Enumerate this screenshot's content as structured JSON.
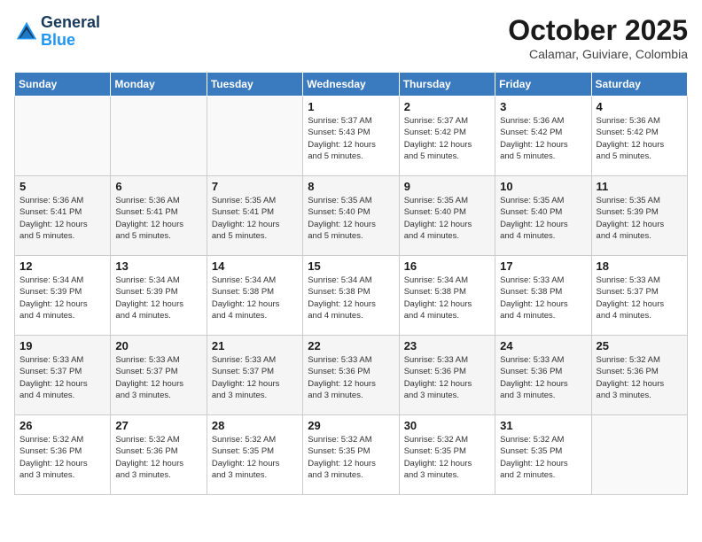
{
  "header": {
    "logo_line1": "General",
    "logo_line2": "Blue",
    "month": "October 2025",
    "location": "Calamar, Guiviare, Colombia"
  },
  "weekdays": [
    "Sunday",
    "Monday",
    "Tuesday",
    "Wednesday",
    "Thursday",
    "Friday",
    "Saturday"
  ],
  "weeks": [
    [
      {
        "day": "",
        "info": ""
      },
      {
        "day": "",
        "info": ""
      },
      {
        "day": "",
        "info": ""
      },
      {
        "day": "1",
        "info": "Sunrise: 5:37 AM\nSunset: 5:43 PM\nDaylight: 12 hours\nand 5 minutes."
      },
      {
        "day": "2",
        "info": "Sunrise: 5:37 AM\nSunset: 5:42 PM\nDaylight: 12 hours\nand 5 minutes."
      },
      {
        "day": "3",
        "info": "Sunrise: 5:36 AM\nSunset: 5:42 PM\nDaylight: 12 hours\nand 5 minutes."
      },
      {
        "day": "4",
        "info": "Sunrise: 5:36 AM\nSunset: 5:42 PM\nDaylight: 12 hours\nand 5 minutes."
      }
    ],
    [
      {
        "day": "5",
        "info": "Sunrise: 5:36 AM\nSunset: 5:41 PM\nDaylight: 12 hours\nand 5 minutes."
      },
      {
        "day": "6",
        "info": "Sunrise: 5:36 AM\nSunset: 5:41 PM\nDaylight: 12 hours\nand 5 minutes."
      },
      {
        "day": "7",
        "info": "Sunrise: 5:35 AM\nSunset: 5:41 PM\nDaylight: 12 hours\nand 5 minutes."
      },
      {
        "day": "8",
        "info": "Sunrise: 5:35 AM\nSunset: 5:40 PM\nDaylight: 12 hours\nand 5 minutes."
      },
      {
        "day": "9",
        "info": "Sunrise: 5:35 AM\nSunset: 5:40 PM\nDaylight: 12 hours\nand 4 minutes."
      },
      {
        "day": "10",
        "info": "Sunrise: 5:35 AM\nSunset: 5:40 PM\nDaylight: 12 hours\nand 4 minutes."
      },
      {
        "day": "11",
        "info": "Sunrise: 5:35 AM\nSunset: 5:39 PM\nDaylight: 12 hours\nand 4 minutes."
      }
    ],
    [
      {
        "day": "12",
        "info": "Sunrise: 5:34 AM\nSunset: 5:39 PM\nDaylight: 12 hours\nand 4 minutes."
      },
      {
        "day": "13",
        "info": "Sunrise: 5:34 AM\nSunset: 5:39 PM\nDaylight: 12 hours\nand 4 minutes."
      },
      {
        "day": "14",
        "info": "Sunrise: 5:34 AM\nSunset: 5:38 PM\nDaylight: 12 hours\nand 4 minutes."
      },
      {
        "day": "15",
        "info": "Sunrise: 5:34 AM\nSunset: 5:38 PM\nDaylight: 12 hours\nand 4 minutes."
      },
      {
        "day": "16",
        "info": "Sunrise: 5:34 AM\nSunset: 5:38 PM\nDaylight: 12 hours\nand 4 minutes."
      },
      {
        "day": "17",
        "info": "Sunrise: 5:33 AM\nSunset: 5:38 PM\nDaylight: 12 hours\nand 4 minutes."
      },
      {
        "day": "18",
        "info": "Sunrise: 5:33 AM\nSunset: 5:37 PM\nDaylight: 12 hours\nand 4 minutes."
      }
    ],
    [
      {
        "day": "19",
        "info": "Sunrise: 5:33 AM\nSunset: 5:37 PM\nDaylight: 12 hours\nand 4 minutes."
      },
      {
        "day": "20",
        "info": "Sunrise: 5:33 AM\nSunset: 5:37 PM\nDaylight: 12 hours\nand 3 minutes."
      },
      {
        "day": "21",
        "info": "Sunrise: 5:33 AM\nSunset: 5:37 PM\nDaylight: 12 hours\nand 3 minutes."
      },
      {
        "day": "22",
        "info": "Sunrise: 5:33 AM\nSunset: 5:36 PM\nDaylight: 12 hours\nand 3 minutes."
      },
      {
        "day": "23",
        "info": "Sunrise: 5:33 AM\nSunset: 5:36 PM\nDaylight: 12 hours\nand 3 minutes."
      },
      {
        "day": "24",
        "info": "Sunrise: 5:33 AM\nSunset: 5:36 PM\nDaylight: 12 hours\nand 3 minutes."
      },
      {
        "day": "25",
        "info": "Sunrise: 5:32 AM\nSunset: 5:36 PM\nDaylight: 12 hours\nand 3 minutes."
      }
    ],
    [
      {
        "day": "26",
        "info": "Sunrise: 5:32 AM\nSunset: 5:36 PM\nDaylight: 12 hours\nand 3 minutes."
      },
      {
        "day": "27",
        "info": "Sunrise: 5:32 AM\nSunset: 5:36 PM\nDaylight: 12 hours\nand 3 minutes."
      },
      {
        "day": "28",
        "info": "Sunrise: 5:32 AM\nSunset: 5:35 PM\nDaylight: 12 hours\nand 3 minutes."
      },
      {
        "day": "29",
        "info": "Sunrise: 5:32 AM\nSunset: 5:35 PM\nDaylight: 12 hours\nand 3 minutes."
      },
      {
        "day": "30",
        "info": "Sunrise: 5:32 AM\nSunset: 5:35 PM\nDaylight: 12 hours\nand 3 minutes."
      },
      {
        "day": "31",
        "info": "Sunrise: 5:32 AM\nSunset: 5:35 PM\nDaylight: 12 hours\nand 2 minutes."
      },
      {
        "day": "",
        "info": ""
      }
    ]
  ]
}
